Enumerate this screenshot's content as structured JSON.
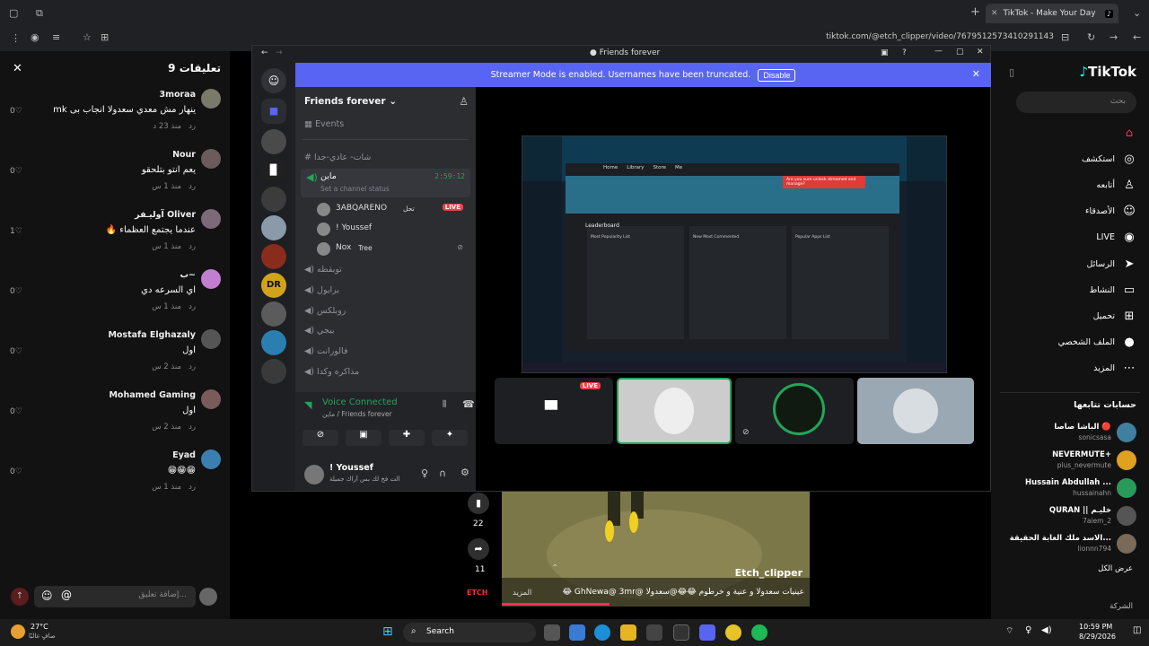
{
  "browser": {
    "tab_title": "TikTok - Make Your Day",
    "url": "tiktok.com/@etch_clipper/video/7679512573410291143"
  },
  "comments_panel": {
    "title": "تعليقات 9",
    "close": "✕",
    "comments": [
      {
        "name": "3moraa",
        "text": "ينهار مش معدي سعدولا انجاب بى mk",
        "time": "منذ 23 د",
        "reply": "رد",
        "likes": "0",
        "avatar_color": "#7a7a6a"
      },
      {
        "name": "Nour",
        "text": "يعم انتو بتلحقو",
        "time": "منذ 1 س",
        "reply": "رد",
        "likes": "0",
        "avatar_color": "#6b5b5b"
      },
      {
        "name": "آوليـفر Oliver",
        "text": "عندما يجتمع العظماء 🔥",
        "time": "منذ 1 س",
        "reply": "رد",
        "likes": "1",
        "avatar_color": "#7c6a78"
      },
      {
        "name": "ب~",
        "text": "اي السرعه دي",
        "time": "منذ 1 س",
        "reply": "رد",
        "likes": "0",
        "avatar_color": "#c27fd0"
      },
      {
        "name": "Mostafa Elghazaly",
        "text": "اول",
        "time": "منذ 2 س",
        "reply": "رد",
        "likes": "0",
        "avatar_color": "#555"
      },
      {
        "name": "Mohamed Gaming",
        "text": "اول",
        "time": "منذ 2 س",
        "reply": "رد",
        "likes": "0",
        "avatar_color": "#7a5b5b"
      },
      {
        "name": "Eyad",
        "text": "😁😁😁",
        "time": "منذ 1 س",
        "reply": "رد",
        "likes": "0",
        "avatar_color": "#3a7fb0"
      }
    ],
    "input_placeholder": "إضافة تعليق..."
  },
  "discord": {
    "window_title": "Friends forever",
    "banner_text": "Streamer Mode is enabled. Usernames have been truncated.",
    "banner_button": "Disable",
    "server_name": "Friends forever",
    "events": "Events",
    "channels": {
      "text_channel": "شات- عادي-جدا",
      "voice_channel": "ماين",
      "voice_timer": "2:59:12",
      "status_hint": "Set a channel status",
      "members": [
        {
          "name": "3ABQARENO",
          "tag": "تحل",
          "badge": "LIVE"
        },
        {
          "name": "! Youssef",
          "tag": "",
          "badge": ""
        },
        {
          "name": "Nox",
          "tag": "Tree",
          "badge": ""
        }
      ],
      "other_voice": [
        "توبقطه",
        "برايول",
        "روبلكس",
        "بيجي",
        "فالورانت",
        "مذاكره وكدا"
      ]
    },
    "voice_panel": {
      "title": "Voice Connected",
      "subtitle": "ماين / Friends forever"
    },
    "user_panel": {
      "name": "! Youssef",
      "status": "الت فخ لك بس آراك جميلة"
    },
    "stage": {
      "live_badge": "LIVE"
    },
    "shared_screen": {
      "nav": [
        "Home",
        "Library",
        "Store",
        "Me"
      ],
      "section": "Leaderboard",
      "columns": [
        "Most Popularity List",
        "New Most Commented",
        "Popular Apps List"
      ],
      "alert": "Are you sure unlock streamed and manage?"
    }
  },
  "tiktok": {
    "logo": "TikTok",
    "search_placeholder": "بحث",
    "nav": [
      {
        "label": "",
        "icon": "home-icon",
        "glyph": "⌂"
      },
      {
        "label": "استكشف",
        "icon": "compass-icon",
        "glyph": "◎"
      },
      {
        "label": "أتابعه",
        "icon": "following-icon",
        "glyph": "♙"
      },
      {
        "label": "الأصدقاء",
        "icon": "friends-icon",
        "glyph": "☺"
      },
      {
        "label": "LIVE",
        "icon": "live-icon",
        "glyph": "◉"
      },
      {
        "label": "الرسائل",
        "icon": "messages-icon",
        "glyph": "➤"
      },
      {
        "label": "النشاط",
        "icon": "activity-icon",
        "glyph": "▭"
      },
      {
        "label": "تحميل",
        "icon": "upload-icon",
        "glyph": "⊞"
      },
      {
        "label": "الملف الشخصي",
        "icon": "profile-icon",
        "glyph": "●"
      },
      {
        "label": "المزيد",
        "icon": "more-icon",
        "glyph": "⋯"
      }
    ],
    "following_title": "حسابات تتابعها",
    "following": [
      {
        "name": "الباشا صاصا 🔴",
        "handle": "sonicsasa",
        "color": "#3f7f9f"
      },
      {
        "name": "NEVERMUTE+",
        "handle": "plus_nevermute",
        "color": "#e0a020"
      },
      {
        "name": "Hussain Abdullah ...",
        "handle": "hussainahn",
        "color": "#2a9a5a"
      },
      {
        "name": "QURAN || خليـم",
        "handle": "7aiem_2",
        "color": "#555"
      },
      {
        "name": "الاسد ملك الغابة الحقيقة...",
        "handle": "lionnn794",
        "color": "#7a6a5a"
      }
    ],
    "show_all": "عرض الكل",
    "company": "الشركة"
  },
  "video": {
    "counts": {
      "saves": "22",
      "shares": "11"
    },
    "author": "Etch_clipper",
    "caption": "عينيات سعدولا و عنية و خرطوم 😂😂@سعدولا @GhNewa@ 3mr 😂",
    "more": "المزيد",
    "brand": "ETCH"
  },
  "taskbar": {
    "weather_temp": "27°C",
    "weather_desc": "صافٍ غالبًا",
    "search": "Search",
    "time": "10:59 PM",
    "date": "8/29/2026"
  }
}
